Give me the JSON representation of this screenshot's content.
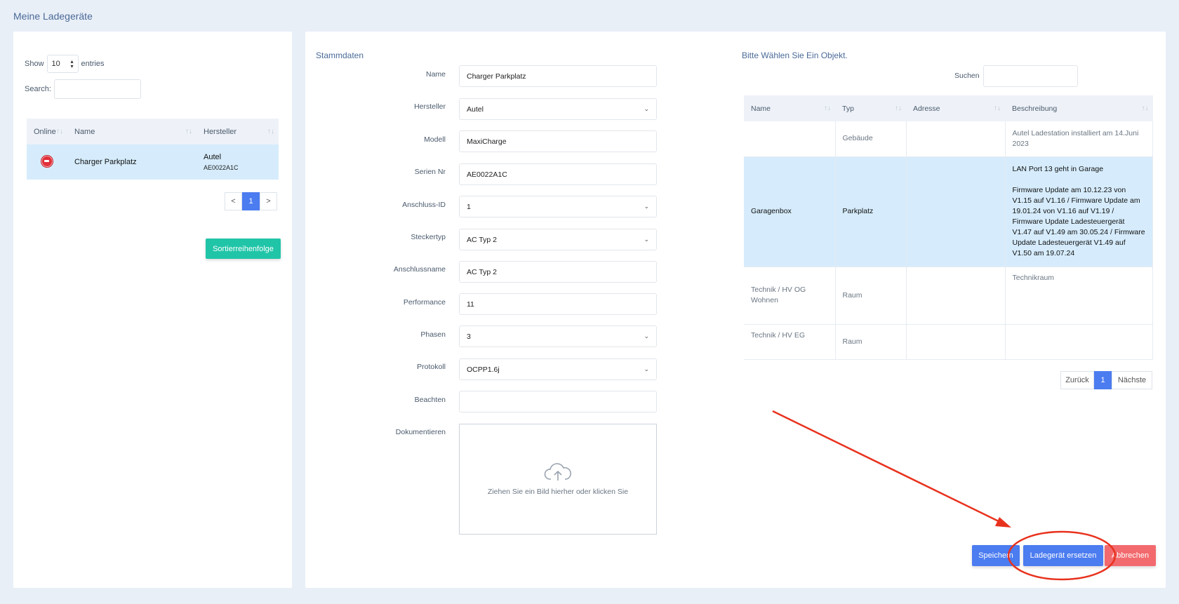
{
  "page": {
    "title": "Meine Ladegeräte"
  },
  "left": {
    "show_label": "Show",
    "entries_value": "10",
    "entries_label": "entries",
    "search_label": "Search:",
    "columns": [
      "Online",
      "Name",
      "Hersteller"
    ],
    "rows": [
      {
        "name": "Charger Parkplatz",
        "manufacturer": "Autel",
        "serial": "AE0022A1C"
      }
    ],
    "pager": {
      "prev": "<",
      "page": "1",
      "next": ">"
    },
    "sort_button": "Sortierreihenfolge"
  },
  "form": {
    "title": "Stammdaten",
    "fields": {
      "name": {
        "label": "Name",
        "value": "Charger Parkplatz"
      },
      "hersteller": {
        "label": "Hersteller",
        "value": "Autel"
      },
      "modell": {
        "label": "Modell",
        "value": "MaxiCharge"
      },
      "serien": {
        "label": "Serien Nr",
        "value": "AE0022A1C"
      },
      "anschluss_id": {
        "label": "Anschluss-ID",
        "value": "1"
      },
      "steckertyp": {
        "label": "Steckertyp",
        "value": "AC Typ 2"
      },
      "anschlussname": {
        "label": "Anschlussname",
        "value": "AC Typ 2"
      },
      "performance": {
        "label": "Performance",
        "value": "11"
      },
      "phasen": {
        "label": "Phasen",
        "value": "3"
      },
      "protokoll": {
        "label": "Protokoll",
        "value": "OCPP1.6j"
      },
      "beachten": {
        "label": "Beachten",
        "value": ""
      },
      "dokumentieren": {
        "label": "Dokumentieren",
        "dropzone_text": "Ziehen Sie ein Bild hierher oder klicken Sie"
      }
    }
  },
  "objects": {
    "title": "Bitte Wählen Sie Ein Objekt.",
    "search_label": "Suchen",
    "columns": [
      "Name",
      "Typ",
      "Adresse",
      "Beschreibung"
    ],
    "rows": [
      {
        "name": "",
        "typ": "Gebäude",
        "adresse": "",
        "beschreibung": "Autel Ladestation installiert am 14.Juni 2023"
      },
      {
        "name": "Garagenbox",
        "typ": "Parkplatz",
        "adresse": "",
        "beschreibung_1": "LAN Port 13 geht in Garage",
        "beschreibung_2": "Firmware Update am 10.12.23 von V1.15 auf V1.16 / Firmware Update am 19.01.24 von V1.16 auf V1.19 / Firmware Update Ladesteuergerät V1.47 auf V1.49 am 30.05.24 / Firmware Update Ladesteuergerät V1.49 auf V1.50 am 19.07.24"
      },
      {
        "name": "Technik / HV OG Wohnen",
        "typ": "Raum",
        "adresse": "",
        "beschreibung": "Technikraum"
      },
      {
        "name": "Technik / HV EG",
        "typ": "Raum",
        "adresse": "",
        "beschreibung": ""
      }
    ],
    "pager": {
      "prev": "Zurück",
      "page": "1",
      "next": "Nächste"
    }
  },
  "actions": {
    "save": "Speichern",
    "replace": "Ladegerät ersetzen",
    "cancel": "Abbrechen"
  },
  "colors": {
    "accent": "#4b7cf0",
    "teal": "#20c5a8",
    "danger": "#f26a6e",
    "annotation": "#e8321e"
  },
  "icons": {
    "online_status": "offline-status-icon",
    "upload": "cloud-upload-icon",
    "sort": "sort-icon",
    "select": "chevron-down-icon"
  }
}
